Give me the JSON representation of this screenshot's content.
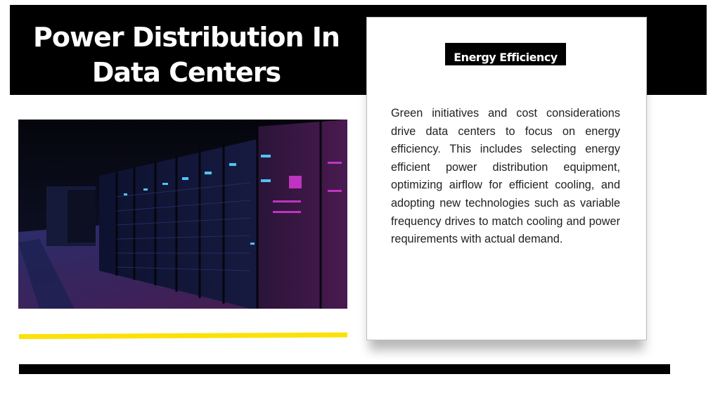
{
  "slide": {
    "title": "Power Distribution In Data Centers",
    "image_alt": "Data center server racks illuminated in blue and magenta light",
    "card": {
      "label": "Energy Efficiency",
      "body": "Green initiatives and cost considerations drive data centers to focus on energy efficiency. This includes selecting energy efficient power distribution equipment, optimizing airflow for efficient cooling, and adopting new technologies such as variable frequency drives to match cooling and power requirements with actual demand."
    }
  },
  "colors": {
    "header_bg": "#000000",
    "accent_yellow": "#fbe108",
    "card_bg": "#ffffff",
    "text": "#222222"
  }
}
